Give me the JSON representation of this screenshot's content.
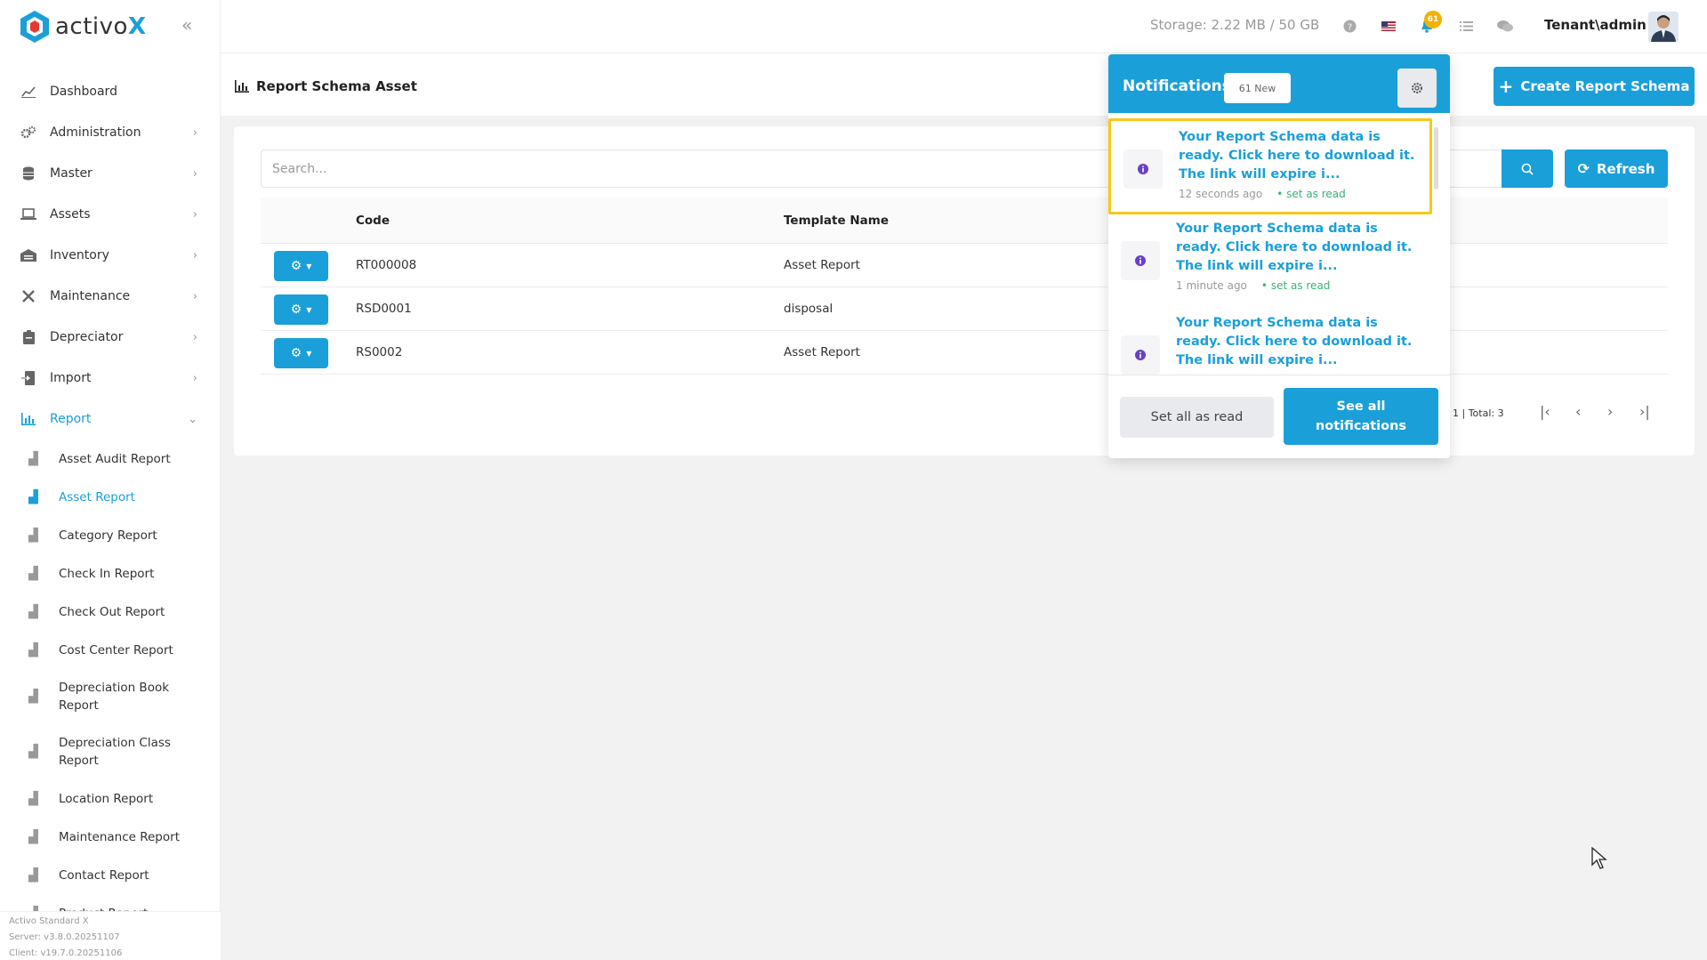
{
  "brand": {
    "name_prefix": "activo",
    "name_suffix": "X"
  },
  "sidebar": {
    "items": [
      {
        "label": "Dashboard",
        "icon": "chart-line-icon",
        "has_children": false
      },
      {
        "label": "Administration",
        "icon": "gears-icon",
        "has_children": true
      },
      {
        "label": "Master",
        "icon": "database-icon",
        "has_children": true
      },
      {
        "label": "Assets",
        "icon": "laptop-icon",
        "has_children": true
      },
      {
        "label": "Inventory",
        "icon": "warehouse-icon",
        "has_children": true
      },
      {
        "label": "Maintenance",
        "icon": "tools-icon",
        "has_children": true
      },
      {
        "label": "Depreciator",
        "icon": "clipboard-icon",
        "has_children": true
      },
      {
        "label": "Import",
        "icon": "file-import-icon",
        "has_children": true
      },
      {
        "label": "Report",
        "icon": "bar-chart-icon",
        "has_children": true,
        "active": true
      }
    ],
    "report_sub": [
      "Asset Audit Report",
      "Asset Report",
      "Category Report",
      "Check In Report",
      "Check Out Report",
      "Cost Center Report",
      "Depreciation Book Report",
      "Depreciation Class Report",
      "Location Report",
      "Maintenance Report",
      "Contact Report",
      "Product Report"
    ],
    "active_sub": "Asset Report",
    "version": {
      "product": "Activo Standard X",
      "server": "Server: v3.8.0.20251107",
      "client": "Client: v19.7.0.20251106"
    }
  },
  "topbar": {
    "storage": "Storage: 2.22 MB / 50 GB",
    "notification_count": "61",
    "user": "Tenant\\admin"
  },
  "page": {
    "title": "Report Schema Asset",
    "create_label": "Create Report Schema",
    "search_placeholder": "Search...",
    "refresh_label": "Refresh",
    "columns": {
      "code": "Code",
      "template": "Template Name"
    },
    "rows": [
      {
        "code": "RT000008",
        "template": "Asset Report"
      },
      {
        "code": "RSD0001",
        "template": "disposal"
      },
      {
        "code": "RS0002",
        "template": "Asset Report"
      }
    ],
    "pager_info": "1 | Total: 3"
  },
  "notifications": {
    "title": "Notifications",
    "new_badge": "61 New",
    "items": [
      {
        "text": "Your Report Schema data is ready. Click here to download it. The link will expire i...",
        "time": "12 seconds ago",
        "action": "set as read"
      },
      {
        "text": "Your Report Schema data is ready. Click here to download it. The link will expire i...",
        "time": "1 minute ago",
        "action": "set as read"
      },
      {
        "text": "Your Report Schema data is ready. Click here to download it. The link will expire i...",
        "time": "",
        "action": ""
      }
    ],
    "set_all_label": "Set all as read",
    "see_all_label": "See all notifications"
  },
  "colors": {
    "accent": "#1a9fd9",
    "highlight": "#f7c81a",
    "badge": "#f2b203",
    "read": "#3bb273"
  }
}
